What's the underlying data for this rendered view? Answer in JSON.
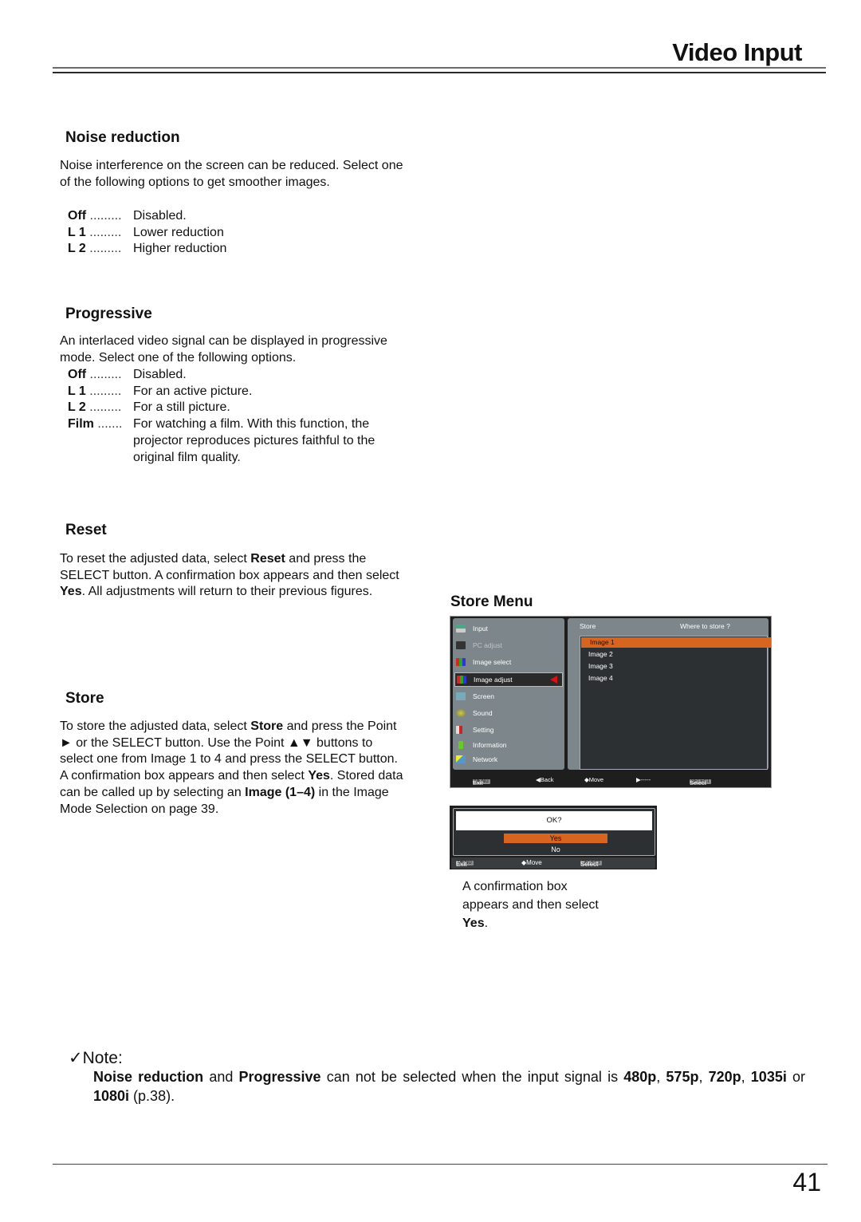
{
  "header": {
    "title": "Video Input"
  },
  "sections": {
    "noise_reduction": {
      "title": "Noise reduction",
      "intro": "Noise interference on the screen can be reduced. Select one of the following options to get smoother images.",
      "options": [
        {
          "key": "Off",
          "dots": " .........",
          "desc": "Disabled."
        },
        {
          "key": "L 1",
          "dots": " .........",
          "desc": "Lower reduction"
        },
        {
          "key": "L 2",
          "dots": " .........",
          "desc": "Higher reduction"
        }
      ]
    },
    "progressive": {
      "title": "Progressive",
      "intro": "An interlaced video signal can be displayed in progressive mode. Select one of the following options.",
      "options": [
        {
          "key": "Off",
          "dots": " .........",
          "desc": "Disabled."
        },
        {
          "key": "L 1",
          "dots": " .........",
          "desc": "For an active picture."
        },
        {
          "key": "L 2",
          "dots": " .........",
          "desc": "For a still picture."
        },
        {
          "key": "Film",
          "dots": " .......",
          "desc": "For watching a film. With this function, the projector reproduces pictures faithful to the original film quality."
        }
      ]
    },
    "reset": {
      "title": "Reset",
      "text_1": "To reset the adjusted data, select ",
      "bold_1": "Reset",
      "text_2": " and press the SELECT button. A confirmation box appears and then select ",
      "bold_2": "Yes",
      "text_3": ". All adjustments will return to their previous figures."
    },
    "store": {
      "title": "Store",
      "text_1": "To store the adjusted data, select ",
      "bold_1": "Store",
      "text_2": " and press the Point ► or the SELECT button. Use the Point ▲▼ buttons to select one from Image 1 to 4 and press the SELECT button.",
      "text_3": "A confirmation box appears and then select ",
      "bold_2": "Yes",
      "text_4": ". Stored data can be called up by selecting an ",
      "bold_3": "Image (1–4)",
      "text_5": " in the Image Mode Selection on page 39."
    }
  },
  "store_menu": {
    "title": "Store Menu",
    "left_items": [
      {
        "label": "Input",
        "icon": "input-icon"
      },
      {
        "label": "PC adjust",
        "icon": "pc-adjust-icon"
      },
      {
        "label": "Image select",
        "icon": "image-select-icon"
      },
      {
        "label": "Image adjust",
        "icon": "image-adjust-icon"
      },
      {
        "label": "Screen",
        "icon": "screen-icon"
      },
      {
        "label": "Sound",
        "icon": "sound-icon"
      },
      {
        "label": "Setting",
        "icon": "setting-icon"
      },
      {
        "label": "Information",
        "icon": "information-icon"
      },
      {
        "label": "Network",
        "icon": "network-icon"
      }
    ],
    "selected_left": "Image adjust",
    "right_header_left": "Store",
    "right_header_right": "Where to store ?",
    "right_items": [
      "Image 1",
      "Image 2",
      "Image 3",
      "Image 4"
    ],
    "selected_right": "Image 1",
    "bottom_bar": {
      "exit_key": "MENU",
      "exit": "Exit",
      "back": "◀Back",
      "move": "◆Move",
      "next": "▶-----",
      "select_key": "SELECT",
      "select": "Select"
    }
  },
  "confirm_dialog": {
    "question": "OK?",
    "yes": "Yes",
    "no": "No",
    "selected": "Yes",
    "bottom_bar": {
      "exit_key": "MENU",
      "exit": "Exit",
      "move": "◆Move",
      "select_key": "SELECT",
      "select": "Select"
    }
  },
  "caption": {
    "text": "A confirmation box appears and then select ",
    "bold": "Yes",
    "end": "."
  },
  "note": {
    "heading": "✓Note:",
    "b1": "Noise reduction",
    "t1": " and ",
    "b2": "Progressive",
    "t2": " can not be selected when the input signal is ",
    "b3": "480p",
    "t3": ", ",
    "b4": "575p",
    "t4": ", ",
    "b5": "720p",
    "t5": ", ",
    "b6": "1035i",
    "t6": " or ",
    "b7": "1080i",
    "t7": " (p.38)."
  },
  "footer": {
    "page_number": "41"
  },
  "colors": {
    "menu_highlight": "#d8651f",
    "menu_panel": "#7d868a",
    "menu_dark": "#2c3033",
    "arrow_red": "#e01010"
  }
}
